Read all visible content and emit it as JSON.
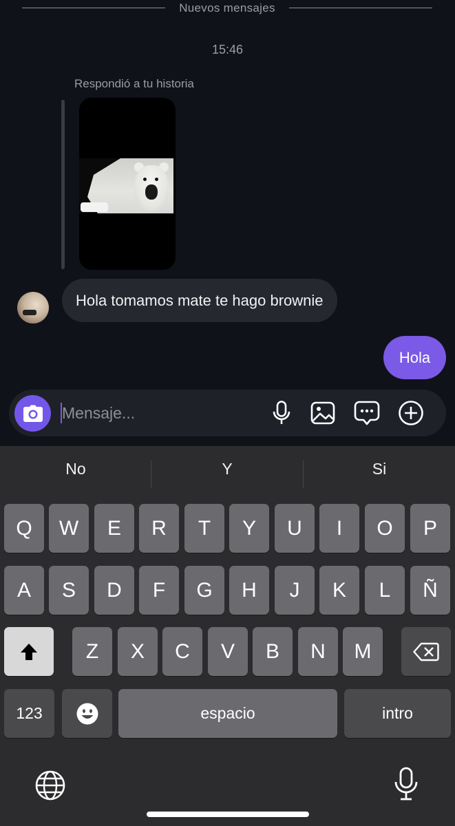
{
  "chat": {
    "divider_label": "Nuevos mensajes",
    "timestamp": "15:46",
    "reply_label": "Respondió a tu historia",
    "incoming_message": "Hola tomamos mate te hago brownie",
    "outgoing_message": "Hola"
  },
  "composer": {
    "placeholder": "Mensaje...",
    "icons": [
      "camera-icon",
      "microphone-icon",
      "gallery-icon",
      "sticker-icon",
      "add-icon"
    ]
  },
  "keyboard": {
    "suggestions": [
      "No",
      "Y",
      "Si"
    ],
    "row1": [
      "Q",
      "W",
      "E",
      "R",
      "T",
      "Y",
      "U",
      "I",
      "O",
      "P"
    ],
    "row2": [
      "A",
      "S",
      "D",
      "F",
      "G",
      "H",
      "J",
      "K",
      "L",
      "Ñ"
    ],
    "row3": [
      "Z",
      "X",
      "C",
      "V",
      "B",
      "N",
      "M"
    ],
    "numbers_key": "123",
    "space_key": "espacio",
    "return_key": "intro",
    "icons": [
      "shift-icon",
      "backspace-icon",
      "emoji-icon",
      "globe-icon",
      "dictation-icon"
    ]
  },
  "colors": {
    "accent": "#7357e8",
    "outgoing_bubble": "#7a5ae6",
    "incoming_bubble": "#262830",
    "background": "#10121a",
    "keyboard_bg": "#2c2c2e",
    "key_bg": "#6b6b6f"
  }
}
